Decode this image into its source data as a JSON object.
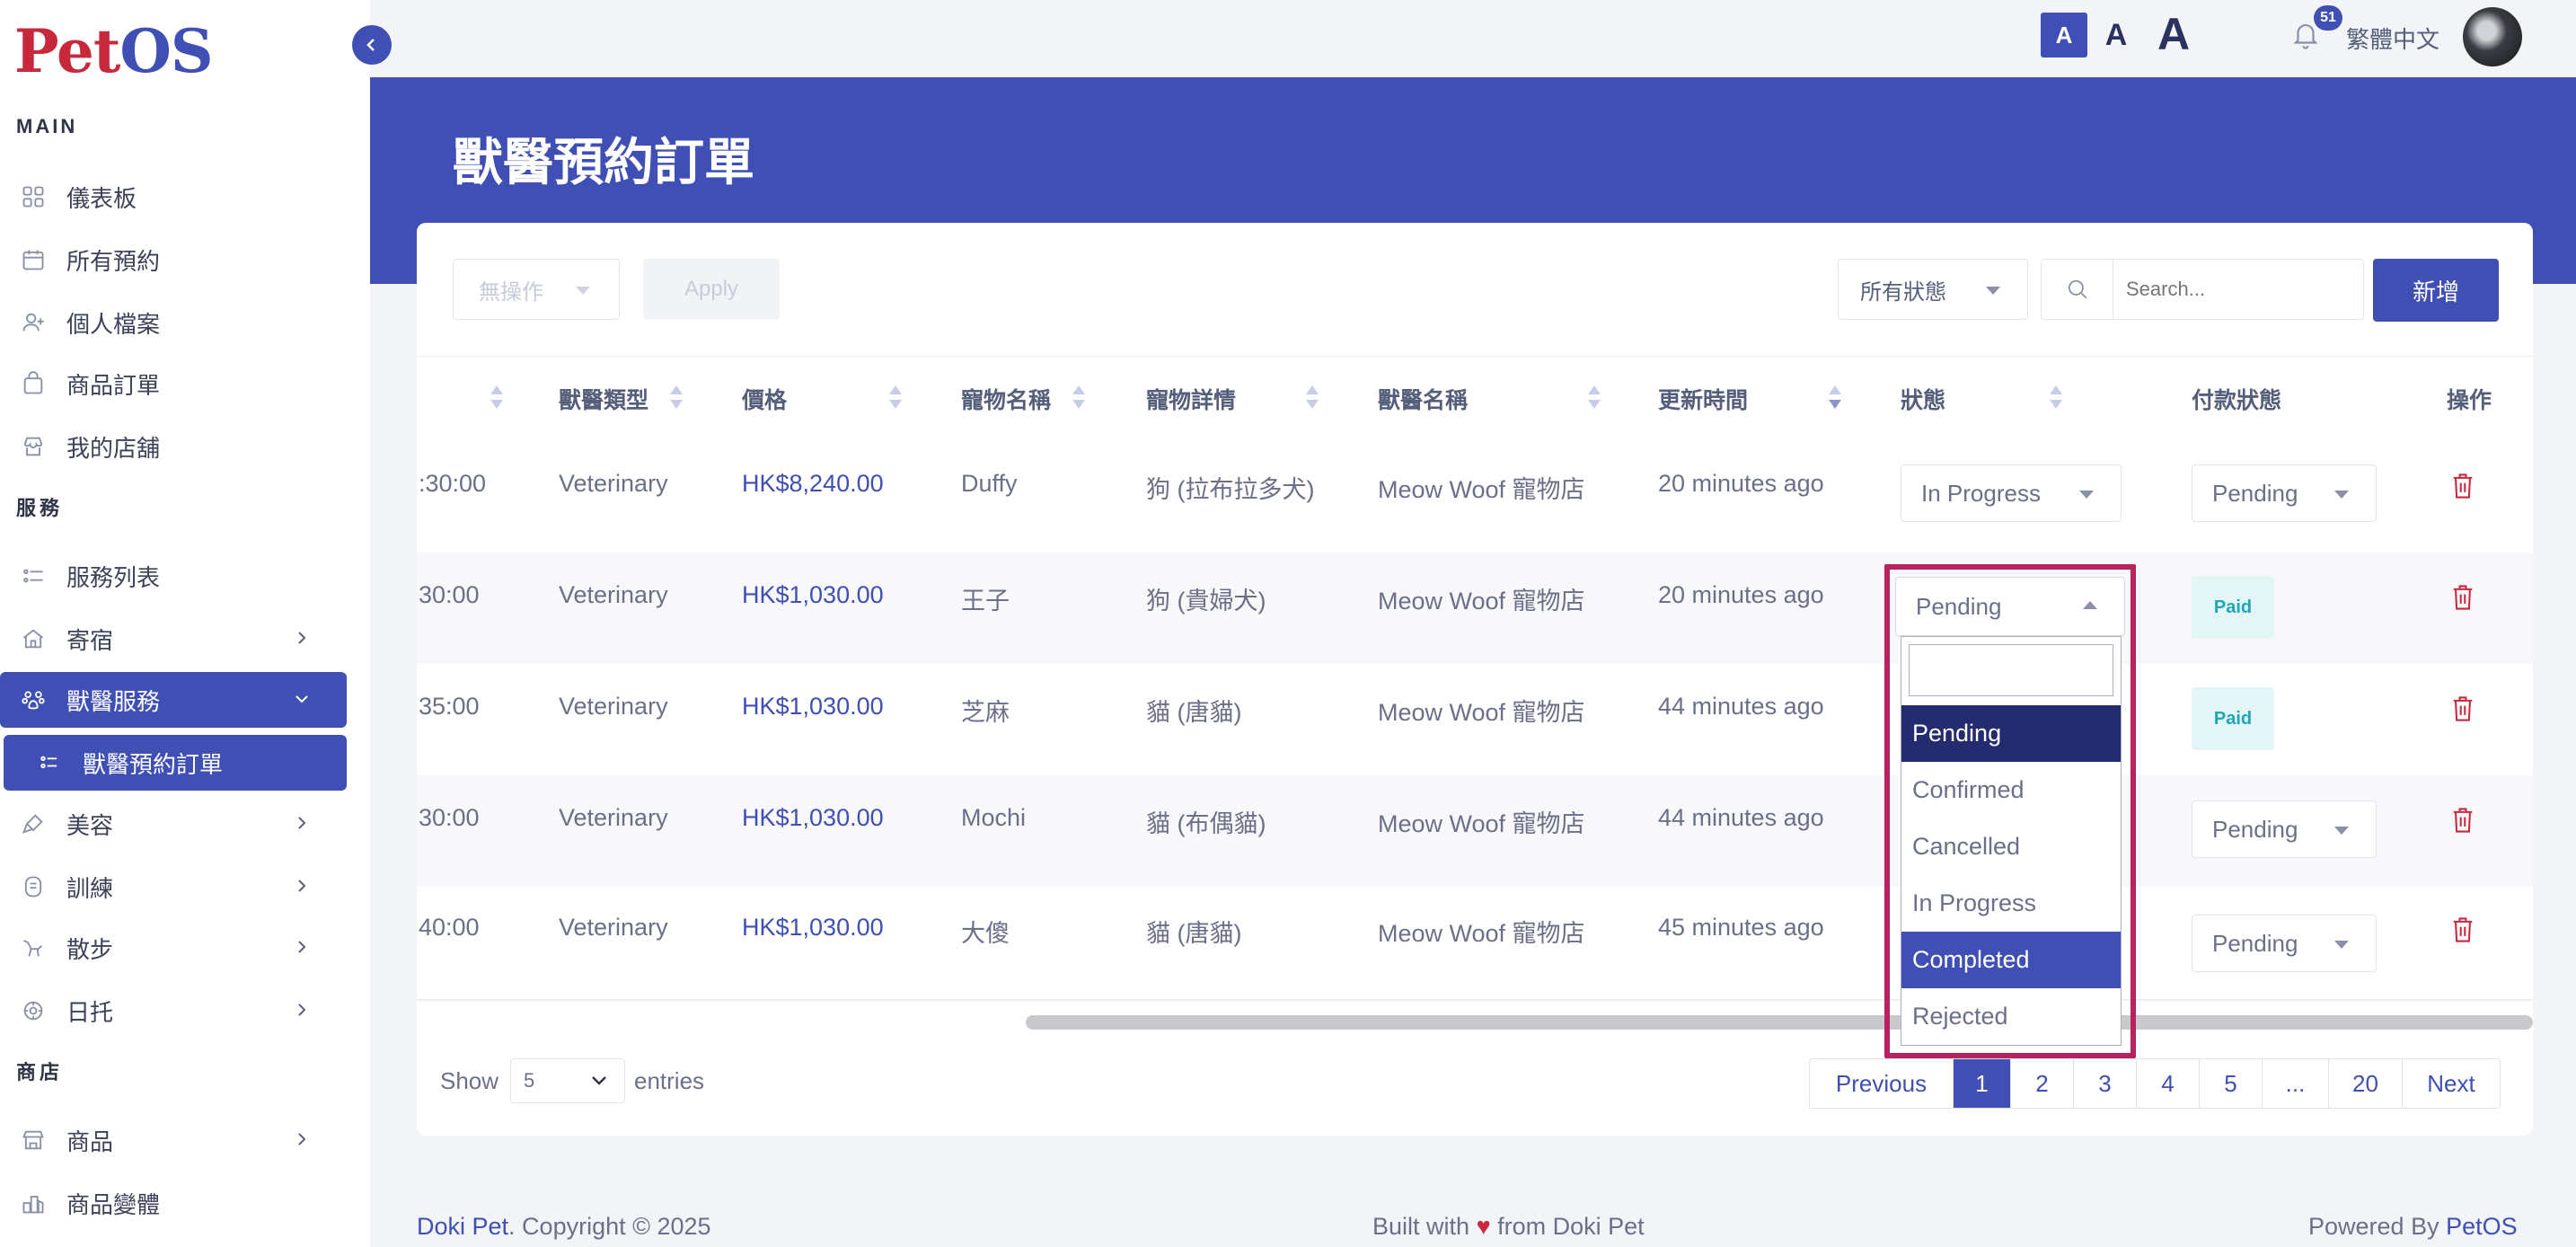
{
  "app": {
    "logo_pet": "Pet",
    "logo_os": "OS"
  },
  "sidebar": {
    "section_main": "MAIN",
    "section_services": "服務",
    "section_shop": "商店",
    "items": [
      {
        "label": "儀表板",
        "icon": "dashboard-icon"
      },
      {
        "label": "所有預約",
        "icon": "calendar-icon"
      },
      {
        "label": "個人檔案",
        "icon": "user-icon"
      },
      {
        "label": "商品訂單",
        "icon": "bag-icon"
      },
      {
        "label": "我的店舖",
        "icon": "store-icon"
      },
      {
        "label": "服務列表",
        "icon": "list-icon"
      },
      {
        "label": "寄宿",
        "icon": "home-icon"
      },
      {
        "label": "獸醫服務",
        "icon": "vet-icon"
      },
      {
        "label": "獸醫預約訂單",
        "icon": "sub-list-icon"
      },
      {
        "label": "美容",
        "icon": "brush-icon"
      },
      {
        "label": "訓練",
        "icon": "training-icon"
      },
      {
        "label": "散步",
        "icon": "walk-icon"
      },
      {
        "label": "日托",
        "icon": "daycare-icon"
      },
      {
        "label": "商品",
        "icon": "shop-icon"
      },
      {
        "label": "商品變體",
        "icon": "variant-icon"
      }
    ]
  },
  "topbar": {
    "font_small": "A",
    "font_medium": "A",
    "font_large": "A",
    "notification_count": "51",
    "language": "繁體中文"
  },
  "page": {
    "title": "獸醫預約訂單"
  },
  "toolbar": {
    "bulk_action": "無操作",
    "apply": "Apply",
    "status_filter": "所有狀態",
    "search_placeholder": "Search...",
    "add": "新增"
  },
  "table": {
    "headers": [
      "獸醫類型",
      "價格",
      "寵物名稱",
      "寵物詳情",
      "獸醫名稱",
      "更新時間",
      "狀態",
      "付款狀態",
      "操作"
    ],
    "rows": [
      {
        "time": ":30:00",
        "type": "Veterinary",
        "price": "HK$8,240.00",
        "pet": "Duffy",
        "detail": "狗 (拉布拉多犬)",
        "vet": "Meow Woof 寵物店",
        "updated": "20 minutes ago",
        "status": "In Progress",
        "payment": "Pending"
      },
      {
        "time": "30:00",
        "type": "Veterinary",
        "price": "HK$1,030.00",
        "pet": "王子",
        "detail": "狗 (貴婦犬)",
        "vet": "Meow Woof 寵物店",
        "updated": "20 minutes ago",
        "status": "Pending",
        "payment": "Paid"
      },
      {
        "time": "35:00",
        "type": "Veterinary",
        "price": "HK$1,030.00",
        "pet": "芝麻",
        "detail": "貓 (唐貓)",
        "vet": "Meow Woof 寵物店",
        "updated": "44 minutes ago",
        "status": "",
        "payment": "Paid"
      },
      {
        "time": "30:00",
        "type": "Veterinary",
        "price": "HK$1,030.00",
        "pet": "Mochi",
        "detail": "貓 (布偶貓)",
        "vet": "Meow Woof 寵物店",
        "updated": "44 minutes ago",
        "status": "",
        "payment": "Pending"
      },
      {
        "time": "40:00",
        "type": "Veterinary",
        "price": "HK$1,030.00",
        "pet": "大傻",
        "detail": "貓 (唐貓)",
        "vet": "Meow Woof 寵物店",
        "updated": "45 minutes ago",
        "status": "",
        "payment": "Pending"
      }
    ]
  },
  "status_dropdown": {
    "current": "Pending",
    "options": [
      "Pending",
      "Confirmed",
      "Cancelled",
      "In Progress",
      "Completed",
      "Rejected"
    ]
  },
  "pagination": {
    "show": "Show",
    "length": "5",
    "entries": "entries",
    "previous": "Previous",
    "pages": [
      "1",
      "2",
      "3",
      "4",
      "5",
      "...",
      "20"
    ],
    "next": "Next"
  },
  "footer": {
    "brand": "Doki Pet",
    "copyright": ". Copyright © 2025",
    "built_with": "Built with",
    "heart": "♥",
    "from": "from Doki Pet",
    "powered_by": "Powered By",
    "petos": "PetOS"
  },
  "colors": {
    "primary": "#3f4fb4",
    "brand_red": "#c7283b",
    "highlight_frame": "#b5245c",
    "paid_text": "#1fa6b8",
    "delete": "#c7283b"
  }
}
